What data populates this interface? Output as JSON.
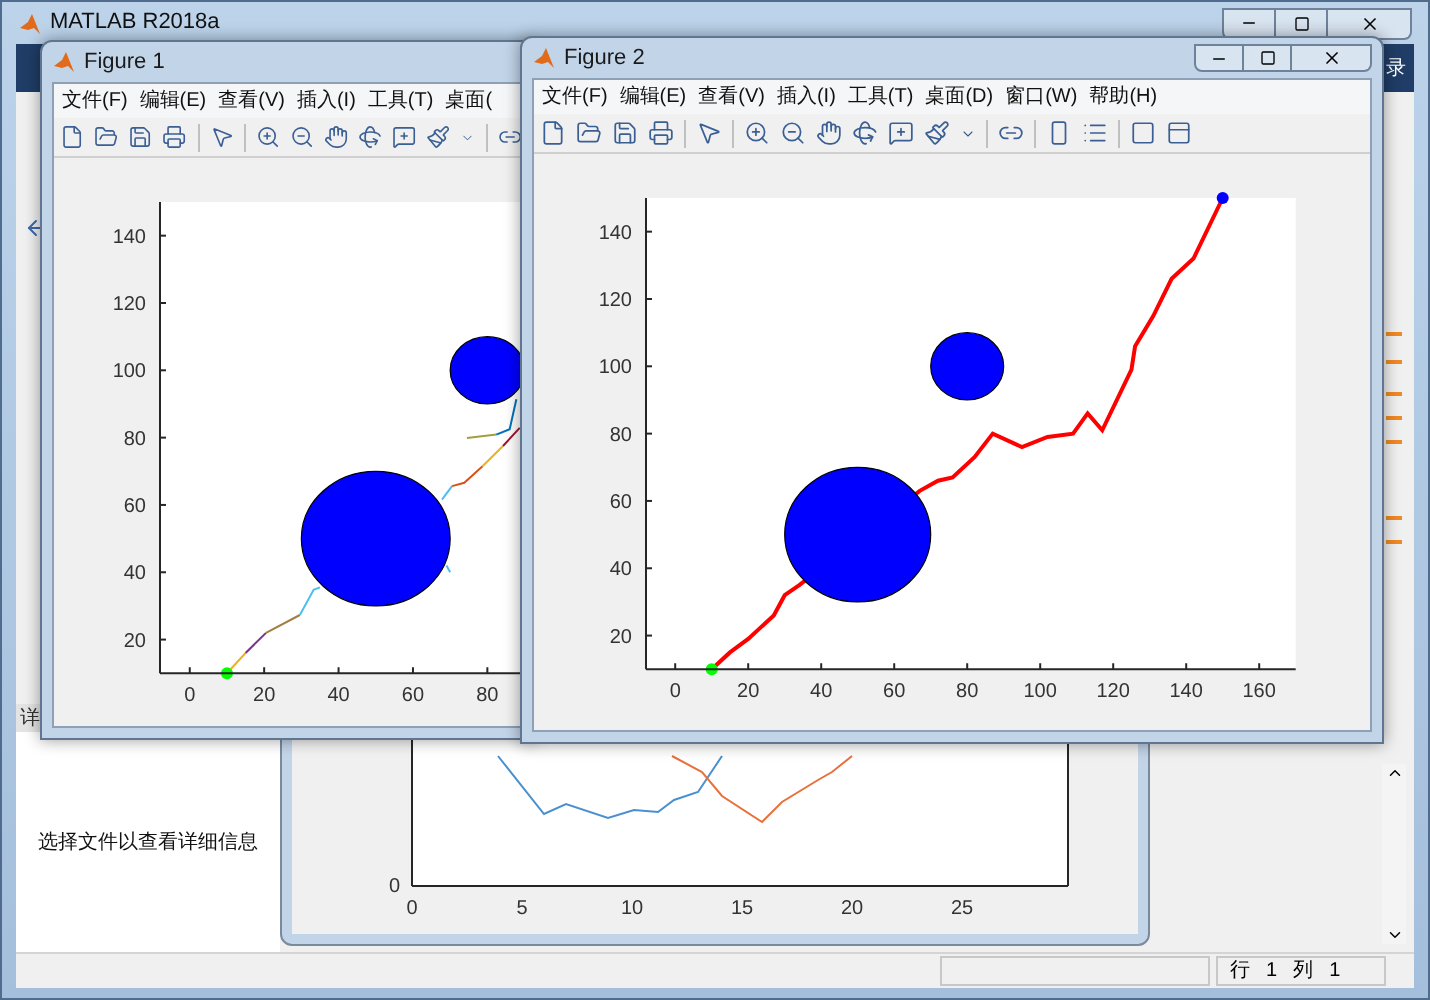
{
  "main_window": {
    "title": "MATLAB R2018a",
    "toolstrip_label": "录",
    "details_header": "详",
    "details_text": "选择文件以查看详细信息",
    "status": [
      {
        "label": "行",
        "value": "1"
      },
      {
        "label": "列",
        "value": "1"
      }
    ]
  },
  "background_figure": {
    "xtick_labels": [
      "0",
      "5",
      "10",
      "15",
      "20",
      "25"
    ],
    "ytick_labels": [
      "0"
    ]
  },
  "figures": [
    {
      "title": "Figure 1",
      "menu": [
        "文件(F)",
        "编辑(E)",
        "查看(V)",
        "插入(I)",
        "工具(T)",
        "桌面("
      ],
      "chart_data": {
        "type": "line",
        "xlim": [
          -8,
          170
        ],
        "ylim": [
          10,
          150
        ],
        "xticks": [
          0,
          20,
          40,
          60,
          80
        ],
        "yticks": [
          20,
          40,
          60,
          80,
          100,
          120,
          140
        ],
        "series": [
          {
            "color": "#edb120",
            "x": [
              10,
              15
            ],
            "values": [
              10,
              16
            ]
          },
          {
            "color": "#7e2f8e",
            "x": [
              15,
              20.5
            ],
            "values": [
              16,
              22
            ]
          },
          {
            "color": "#a08040",
            "x": [
              20.5,
              29.6
            ],
            "values": [
              22,
              27.3
            ]
          },
          {
            "color": "#4dbeee",
            "x": [
              29.6,
              33.3,
              35
            ],
            "values": [
              27.3,
              34.8,
              35.5
            ]
          },
          {
            "color": "#4dbeee",
            "x": [
              67.8,
              70.5
            ],
            "values": [
              61.6,
              65.6
            ]
          },
          {
            "color": "#d95319",
            "x": [
              70.5,
              73.8,
              78.7
            ],
            "values": [
              65.6,
              66.6,
              71.5
            ]
          },
          {
            "color": "#edb120",
            "x": [
              78.7,
              84.2
            ],
            "values": [
              71.5,
              77.5
            ]
          },
          {
            "color": "#a2142f",
            "x": [
              84.2,
              88.7
            ],
            "values": [
              77.5,
              82.9
            ]
          },
          {
            "color": "#a0a040",
            "x": [
              74.5,
              82.4
            ],
            "values": [
              79.9,
              80.9
            ]
          },
          {
            "color": "#0072bd",
            "x": [
              82.4,
              86,
              87.8
            ],
            "values": [
              80.9,
              82.5,
              91.4
            ]
          },
          {
            "color": "#4dbeee",
            "x": [
              69,
              70
            ],
            "values": [
              42,
              40
            ]
          },
          {
            "color": "#00ff00",
            "marker": "circle",
            "x": [
              10
            ],
            "values": [
              10
            ]
          }
        ]
      }
    },
    {
      "title": "Figure 2",
      "menu": [
        "文件(F)",
        "编辑(E)",
        "查看(V)",
        "插入(I)",
        "工具(T)",
        "桌面(D)",
        "窗口(W)",
        "帮助(H)"
      ],
      "chart_data": {
        "type": "line",
        "xlim": [
          -8,
          170
        ],
        "ylim": [
          10,
          150
        ],
        "xticks": [
          0,
          20,
          40,
          60,
          80,
          100,
          120,
          140,
          160
        ],
        "yticks": [
          20,
          40,
          60,
          80,
          100,
          120,
          140
        ],
        "series": [
          {
            "color": "#ff0000",
            "x": [
              10,
              15,
              20,
              27,
              30,
              34,
              67,
              72,
              76,
              82,
              87,
              95,
              102,
              109,
              113,
              117,
              125,
              126,
              131,
              136,
              142,
              150
            ],
            "values": [
              10,
              15,
              19,
              26,
              32,
              35,
              63,
              66,
              67,
              73,
              80,
              76,
              79,
              80,
              86,
              81,
              99,
              106,
              115,
              126,
              132,
              150
            ]
          },
          {
            "color": "#00ff00",
            "marker": "circle",
            "x": [
              10
            ],
            "values": [
              10
            ]
          },
          {
            "color": "#0000ff",
            "marker": "circle",
            "x": [
              150
            ],
            "values": [
              150
            ]
          }
        ]
      }
    }
  ]
}
